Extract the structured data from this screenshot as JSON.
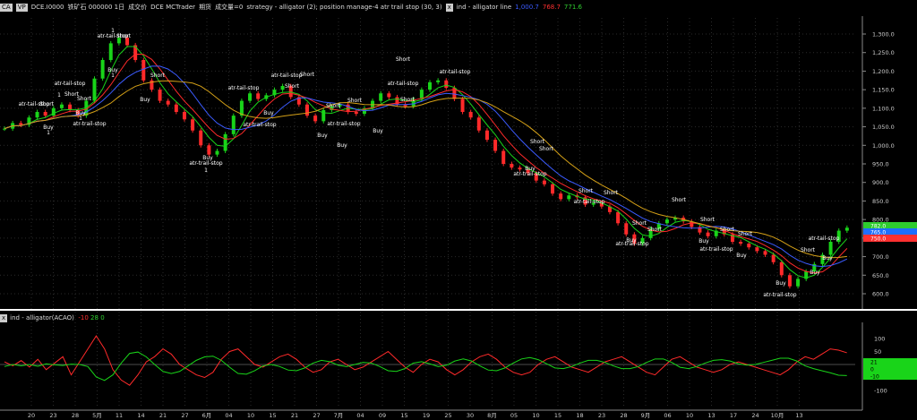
{
  "header": {
    "symbol_box": "CA",
    "period_box": "VP",
    "exchange_code": "DCE.I0000",
    "instrument": "铁矿石 000000 1日",
    "price_type": "成交价",
    "feed": "DCE MCTrader",
    "futures_label": "期货",
    "volume_label": "成交量=0",
    "strategy": "strategy - alligator (2); position manage-4 atr trail stop (30, 3)",
    "indicator": "ind - alligator line",
    "values": [
      "1,000.7",
      "768.7",
      "771.6"
    ]
  },
  "subpane": {
    "title": "ind - alligator(ACAO)",
    "values": [
      "-10",
      "28",
      "0"
    ]
  },
  "price_axis": [
    "1,300.0",
    "1,250.0",
    "1,200.0",
    "1,150.0",
    "1,100.0",
    "1,050.0",
    "1,000.0",
    "950.0",
    "900.0",
    "850.0",
    "800.0",
    "750.0",
    "700.0",
    "650.0",
    "600.0"
  ],
  "osc_axis": [
    "100",
    "50",
    "0",
    "-50",
    "-100"
  ],
  "right_badges": {
    "price": [
      "782.0",
      "765.0",
      "750.0"
    ],
    "osc": [
      "21",
      "0",
      "-10"
    ]
  },
  "date_axis": [
    "20",
    "23",
    "28",
    "5月",
    "11",
    "14",
    "21",
    "27",
    "6月",
    "04",
    "10",
    "15",
    "21",
    "27",
    "7月",
    "04",
    "09",
    "15",
    "19",
    "25",
    "30",
    "8月",
    "05",
    "10",
    "15",
    "18",
    "23",
    "28",
    "9月",
    "06",
    "10",
    "13",
    "17",
    "24",
    "10月",
    "13"
  ],
  "signals": [
    {
      "label": "atr-tail-stop",
      "x": 126,
      "y": 42
    },
    {
      "label": "Short",
      "x": 138,
      "y": 42
    },
    {
      "label": "1",
      "x": 126,
      "y": 36
    },
    {
      "label": "Buy",
      "x": 126,
      "y": 80
    },
    {
      "label": "1",
      "x": 126,
      "y": 86
    },
    {
      "label": "atr-tail-stop",
      "x": 78,
      "y": 95
    },
    {
      "label": "1",
      "x": 66,
      "y": 108
    },
    {
      "label": "Short",
      "x": 80,
      "y": 107
    },
    {
      "label": "atr-tail-stop",
      "x": 38,
      "y": 118
    },
    {
      "label": "Short",
      "x": 52,
      "y": 118
    },
    {
      "label": "Buy",
      "x": 90,
      "y": 128
    },
    {
      "label": "1",
      "x": 90,
      "y": 134
    },
    {
      "label": "atr-trail-stop",
      "x": 100,
      "y": 140
    },
    {
      "label": "Short",
      "x": 94,
      "y": 112
    },
    {
      "label": "Buy",
      "x": 54,
      "y": 144
    },
    {
      "label": "1",
      "x": 54,
      "y": 150
    },
    {
      "label": "Short",
      "x": 176,
      "y": 86
    },
    {
      "label": "Buy",
      "x": 162,
      "y": 113
    },
    {
      "label": "atr-tail-stop",
      "x": 272,
      "y": 100
    },
    {
      "label": "Buy",
      "x": 300,
      "y": 128
    },
    {
      "label": "atr-trail-stop",
      "x": 290,
      "y": 141
    },
    {
      "label": "Buy",
      "x": 232,
      "y": 178
    },
    {
      "label": "atr-trail-stop",
      "x": 230,
      "y": 184
    },
    {
      "label": "1",
      "x": 230,
      "y": 192
    },
    {
      "label": "atr-tail-stop",
      "x": 320,
      "y": 86
    },
    {
      "label": "Short",
      "x": 343,
      "y": 85
    },
    {
      "label": "Short",
      "x": 326,
      "y": 98
    },
    {
      "label": "Short",
      "x": 372,
      "y": 120
    },
    {
      "label": "Short",
      "x": 396,
      "y": 114
    },
    {
      "label": "atr-trail-stop",
      "x": 384,
      "y": 140
    },
    {
      "label": "Buy",
      "x": 360,
      "y": 153
    },
    {
      "label": "Buy",
      "x": 382,
      "y": 164
    },
    {
      "label": "Buy",
      "x": 422,
      "y": 148
    },
    {
      "label": "Short",
      "x": 450,
      "y": 68
    },
    {
      "label": "atr-tail-stop",
      "x": 450,
      "y": 95
    },
    {
      "label": "Short",
      "x": 455,
      "y": 113
    },
    {
      "label": "atr-tail-stop",
      "x": 508,
      "y": 82
    },
    {
      "label": "Short",
      "x": 600,
      "y": 160
    },
    {
      "label": "Short",
      "x": 610,
      "y": 168
    },
    {
      "label": "Buy",
      "x": 592,
      "y": 190
    },
    {
      "label": "atr-trail-stop",
      "x": 592,
      "y": 196
    },
    {
      "label": "Short",
      "x": 654,
      "y": 215
    },
    {
      "label": "Short",
      "x": 682,
      "y": 217
    },
    {
      "label": "atr-tail-stop",
      "x": 658,
      "y": 227
    },
    {
      "label": "Short",
      "x": 714,
      "y": 251
    },
    {
      "label": "Short",
      "x": 731,
      "y": 258
    },
    {
      "label": "Buy",
      "x": 705,
      "y": 270
    },
    {
      "label": "atr-trail-stop",
      "x": 706,
      "y": 274
    },
    {
      "label": "Short",
      "x": 758,
      "y": 225
    },
    {
      "label": "Short",
      "x": 790,
      "y": 247
    },
    {
      "label": "Short",
      "x": 812,
      "y": 258
    },
    {
      "label": "Short",
      "x": 832,
      "y": 263
    },
    {
      "label": "Buy",
      "x": 786,
      "y": 271
    },
    {
      "label": "atr-trail-stop",
      "x": 800,
      "y": 280
    },
    {
      "label": "Buy",
      "x": 828,
      "y": 287
    },
    {
      "label": "Short",
      "x": 902,
      "y": 281
    },
    {
      "label": "Buy",
      "x": 872,
      "y": 318
    },
    {
      "label": "atr-trail-stop",
      "x": 871,
      "y": 331
    },
    {
      "label": "atr-tail-stop",
      "x": 920,
      "y": 268
    },
    {
      "label": "Buy",
      "x": 924,
      "y": 290
    },
    {
      "label": "Buy",
      "x": 910,
      "y": 306
    }
  ],
  "chart_data": {
    "type": "line",
    "title": "",
    "ylim": [
      580,
      1330
    ],
    "yticks": [
      600,
      650,
      700,
      750,
      800,
      850,
      900,
      950,
      1000,
      1050,
      1100,
      1150,
      1200,
      1250,
      1300
    ],
    "close_series": [
      1045,
      1060,
      1055,
      1075,
      1090,
      1080,
      1100,
      1110,
      1095,
      1080,
      1120,
      1180,
      1230,
      1275,
      1290,
      1270,
      1230,
      1175,
      1150,
      1120,
      1110,
      1090,
      1070,
      1040,
      1000,
      975,
      985,
      1030,
      1080,
      1120,
      1140,
      1125,
      1135,
      1150,
      1160,
      1130,
      1110,
      1080,
      1065,
      1095,
      1105,
      1110,
      1090,
      1085,
      1100,
      1120,
      1140,
      1130,
      1110,
      1105,
      1125,
      1150,
      1170,
      1175,
      1155,
      1125,
      1090,
      1075,
      1040,
      1015,
      985,
      950,
      940,
      935,
      925,
      905,
      895,
      870,
      855,
      865,
      860,
      840,
      845,
      835,
      820,
      790,
      760,
      735,
      750,
      775,
      790,
      800,
      805,
      795,
      780,
      765,
      755,
      770,
      760,
      740,
      735,
      725,
      715,
      705,
      685,
      650,
      620,
      640,
      660,
      680,
      705,
      740,
      770,
      778
    ],
    "osc_series": [
      10,
      -5,
      15,
      -10,
      20,
      -20,
      5,
      30,
      -40,
      10,
      60,
      110,
      60,
      -20,
      -60,
      -80,
      -40,
      10,
      30,
      60,
      40,
      0,
      -20,
      -40,
      -50,
      -30,
      20,
      50,
      60,
      30,
      0,
      -10,
      10,
      30,
      40,
      20,
      -10,
      -30,
      -20,
      10,
      20,
      0,
      -20,
      -10,
      10,
      30,
      50,
      20,
      -10,
      -30,
      0,
      20,
      10,
      -20,
      -40,
      -20,
      10,
      30,
      40,
      20,
      -10,
      -30,
      -40,
      -30,
      0,
      20,
      30,
      10,
      -10,
      -20,
      -30,
      -10,
      10,
      20,
      30,
      10,
      -10,
      -30,
      -40,
      -10,
      20,
      30,
      10,
      -10,
      -20,
      -30,
      -20,
      0,
      10,
      0,
      -10,
      -20,
      -30,
      -40,
      -20,
      10,
      30,
      20,
      40,
      60,
      55,
      45
    ]
  }
}
